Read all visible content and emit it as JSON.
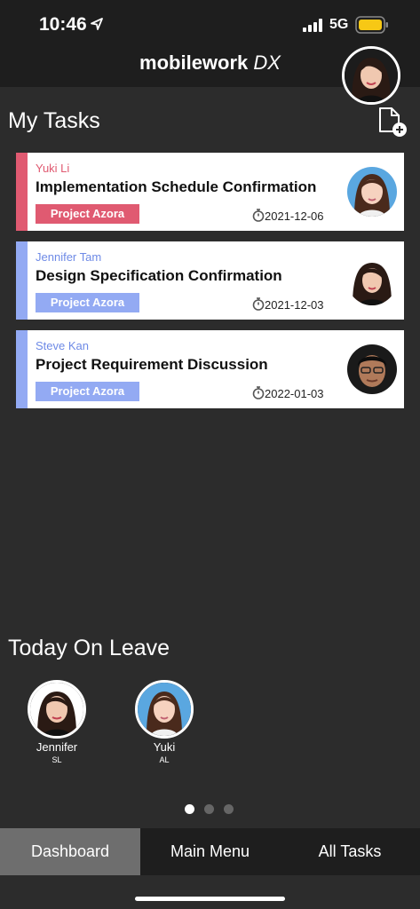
{
  "status": {
    "time": "10:46",
    "network": "5G"
  },
  "header": {
    "brand": "mobilework",
    "brand_suffix": "DX"
  },
  "tasks_section": {
    "title": "My Tasks"
  },
  "tasks": [
    {
      "assignee": "Yuki Li",
      "title": "Implementation Schedule Confirmation",
      "project": "Project Azora",
      "date": "2021-12-06",
      "accent": "#e05a71",
      "assignee_color": "#e05a71"
    },
    {
      "assignee": "Jennifer Tam",
      "title": "Design Specification Confirmation",
      "project": "Project Azora",
      "date": "2021-12-03",
      "accent": "#93aaf3",
      "assignee_color": "#6e8ae6"
    },
    {
      "assignee": "Steve Kan",
      "title": "Project Requirement Discussion",
      "project": "Project Azora",
      "date": "2022-01-03",
      "accent": "#93aaf3",
      "assignee_color": "#6e8ae6"
    }
  ],
  "leave_section": {
    "title": "Today On Leave"
  },
  "leave": [
    {
      "name": "Jennifer",
      "type": "SL"
    },
    {
      "name": "Yuki",
      "type": "AL"
    }
  ],
  "pager": {
    "pages": 3,
    "current": 1
  },
  "tabs": [
    {
      "label": "Dashboard",
      "active": true
    },
    {
      "label": "Main Menu",
      "active": false
    },
    {
      "label": "All Tasks",
      "active": false
    }
  ]
}
